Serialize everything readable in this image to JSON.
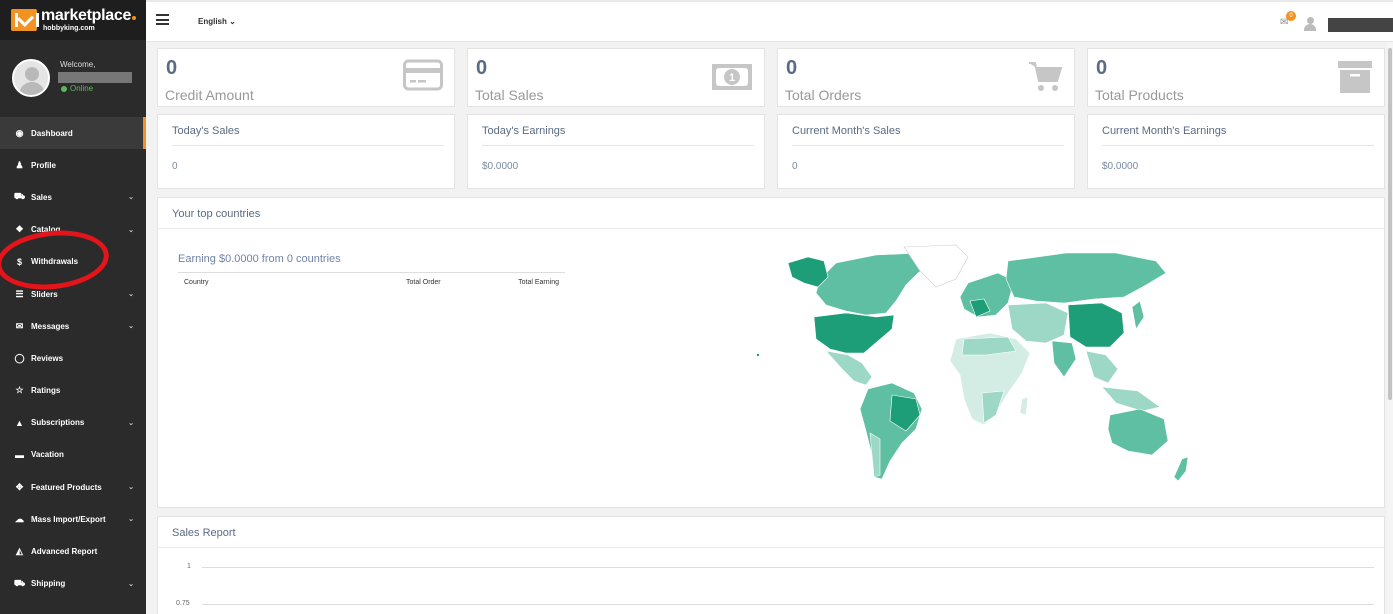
{
  "brand": {
    "logo_main": "marketplace",
    "logo_sub": "hobbyking.com",
    "accent_color": "#f29223"
  },
  "user_panel": {
    "welcome": "Welcome,",
    "status": "Online"
  },
  "nav": {
    "items": [
      {
        "label": "Dashboard",
        "icon": "dashboard-icon",
        "active": true,
        "chevron": false
      },
      {
        "label": "Profile",
        "icon": "profile-icon",
        "chevron": false
      },
      {
        "label": "Sales",
        "icon": "cart-icon",
        "chevron": true
      },
      {
        "label": "Catalog",
        "icon": "catalog-icon",
        "chevron": true
      },
      {
        "label": "Withdrawals",
        "icon": "dollar-icon",
        "chevron": false
      },
      {
        "label": "Sliders",
        "icon": "sliders-icon",
        "chevron": true
      },
      {
        "label": "Messages",
        "icon": "envelope-icon",
        "chevron": true
      },
      {
        "label": "Reviews",
        "icon": "comment-icon",
        "chevron": false
      },
      {
        "label": "Ratings",
        "icon": "star-icon",
        "chevron": false
      },
      {
        "label": "Subscriptions",
        "icon": "thumbs-up-icon",
        "chevron": true
      },
      {
        "label": "Vacation",
        "icon": "bed-icon",
        "chevron": false
      },
      {
        "label": "Featured Products",
        "icon": "crosshair-icon",
        "chevron": true
      },
      {
        "label": "Mass Import/Export",
        "icon": "cloud-upload-icon",
        "chevron": true
      },
      {
        "label": "Advanced Report",
        "icon": "area-chart-icon",
        "chevron": false
      },
      {
        "label": "Shipping",
        "icon": "truck-icon",
        "chevron": true
      }
    ]
  },
  "topbar": {
    "language": "English ⌄",
    "notification_count": "0"
  },
  "stats": [
    {
      "value": "0",
      "label": "Credit Amount",
      "icon": "credit-card-icon"
    },
    {
      "value": "0",
      "label": "Total Sales",
      "icon": "money-bill-icon"
    },
    {
      "value": "0",
      "label": "Total Orders",
      "icon": "shopping-cart-icon"
    },
    {
      "value": "0",
      "label": "Total Products",
      "icon": "archive-box-icon"
    }
  ],
  "summaries": [
    {
      "title": "Today's Sales",
      "value": "0"
    },
    {
      "title": "Today's Earnings",
      "value": "$0.0000"
    },
    {
      "title": "Current Month's Sales",
      "value": "0"
    },
    {
      "title": "Current Month's Earnings",
      "value": "$0.0000"
    }
  ],
  "countries_panel": {
    "title": "Your top countries",
    "earning_text": "Earning $0.0000 from 0 countries",
    "columns": [
      "Country",
      "Total Order",
      "Total Earning"
    ],
    "map_colors": {
      "dark": "#1e9e78",
      "mid": "#5fbfa3",
      "light": "#9dd7c5",
      "pale": "#d3ece4"
    }
  },
  "sales_report": {
    "title": "Sales Report",
    "y_ticks": [
      "1",
      "0.75"
    ]
  }
}
